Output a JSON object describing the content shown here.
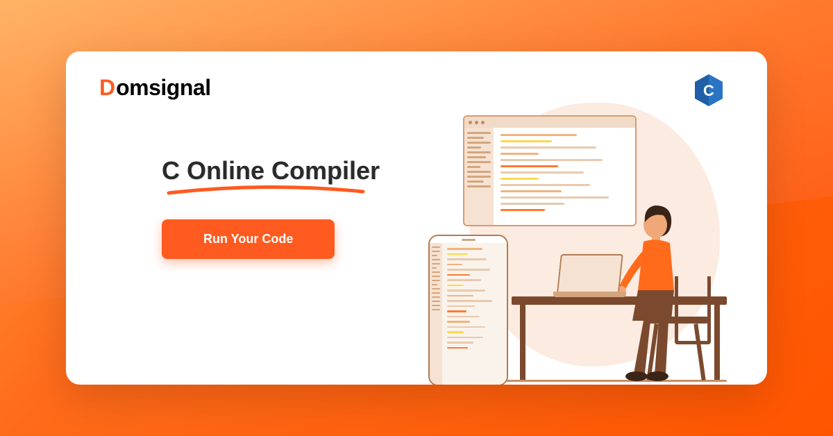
{
  "logo": {
    "first": "D",
    "rest": "omsignal"
  },
  "hero": {
    "title": "C Online Compiler",
    "cta": "Run Your Code"
  },
  "badge": {
    "letter": "C"
  }
}
